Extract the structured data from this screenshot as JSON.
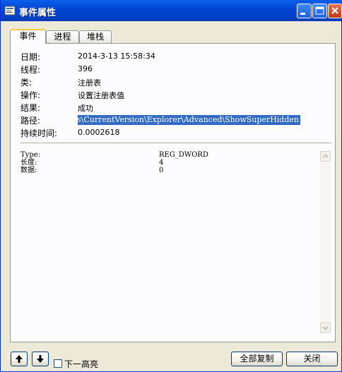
{
  "window": {
    "title": "事件属性",
    "controls": [
      "minimize-icon",
      "maximize-icon",
      "close-icon"
    ]
  },
  "tabs": [
    {
      "label": "事件",
      "active": true
    },
    {
      "label": "进程",
      "active": false
    },
    {
      "label": "堆栈",
      "active": false
    }
  ],
  "properties": [
    {
      "label": "日期:",
      "value": "2014-3-13 15:58:34"
    },
    {
      "label": "线程:",
      "value": "396"
    },
    {
      "label": "类:",
      "value": "注册表"
    },
    {
      "label": "操作:",
      "value": "设置注册表值"
    },
    {
      "label": "结果:",
      "value": "成功"
    },
    {
      "label": "路径:",
      "value": "lows\\CurrentVersion\\Explorer\\Advanced\\ShowSuperHidden"
    },
    {
      "label": "持续时间:",
      "value": "0.0002618"
    }
  ],
  "details": [
    {
      "key": "Type:",
      "value": "REG_DWORD"
    },
    {
      "key": "长度:",
      "value": "4"
    },
    {
      "key": "数据:",
      "value": "0"
    }
  ],
  "bottom": {
    "up_icon": "arrow-up-icon",
    "down_icon": "arrow-down-icon",
    "next_highlight_label": "下一高亮",
    "next_highlight_checked": false,
    "copy_all_label": "全部复制",
    "close_label": "关闭"
  }
}
